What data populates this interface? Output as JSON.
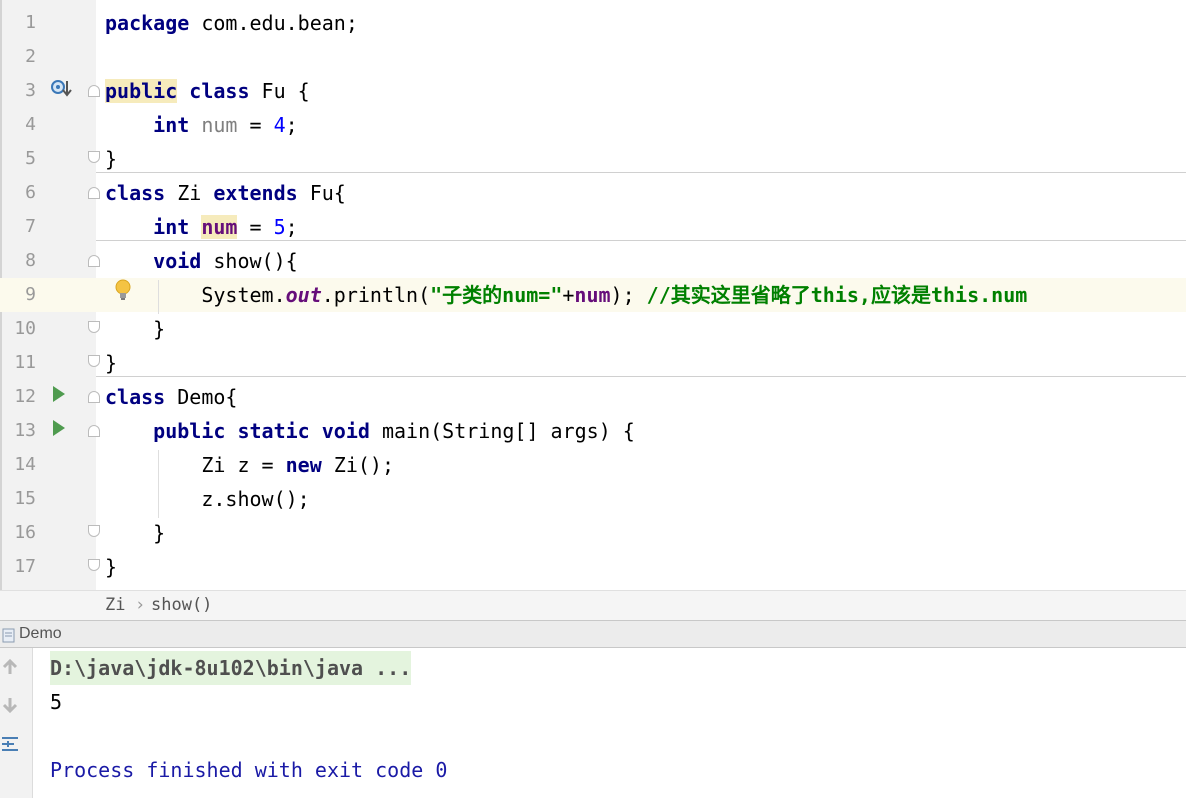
{
  "editor": {
    "line_numbers": [
      "1",
      "2",
      "3",
      "4",
      "5",
      "6",
      "7",
      "8",
      "9",
      "10",
      "11",
      "12",
      "13",
      "14",
      "15",
      "16",
      "17"
    ],
    "lines": {
      "l1": {
        "kw": "package",
        "rest": " com.edu.bean;"
      },
      "l3": {
        "kw_public": "public",
        "kw_class": "class",
        "rest": " Fu {"
      },
      "l4": {
        "kw": "int",
        "field": "num",
        "eq": " = ",
        "num": "4",
        "end": ";"
      },
      "l5": {
        "text": "}"
      },
      "l6": {
        "kw_class": "class",
        "mid": " Zi ",
        "kw_extends": "extends",
        "rest": " Fu{"
      },
      "l7": {
        "kw": "int",
        "field": "num",
        "eq": " = ",
        "num": "5",
        "end": ";"
      },
      "l8": {
        "kw": "void",
        "rest": " show(){"
      },
      "l9": {
        "pre": "System.",
        "static_field": "out",
        "call": ".println(",
        "str": "\"子类的num=\"",
        "plus": "+",
        "field": "num",
        "end": "); ",
        "comment": "//其实这里省略了this,应该是this.num"
      },
      "l10": {
        "text": "}"
      },
      "l11": {
        "text": "}"
      },
      "l12": {
        "kw_class": "class",
        "rest": " Demo{"
      },
      "l13": {
        "kw_public": "public",
        "kw_static": "static",
        "kw_void": "void",
        "rest": " main(String[] args) {"
      },
      "l14": {
        "pre": "Zi z = ",
        "kw": "new",
        "rest": " Zi();"
      },
      "l15": {
        "text": "z.show();"
      },
      "l16": {
        "text": "}"
      },
      "l17": {
        "text": "}"
      }
    }
  },
  "breadcrumb": {
    "class_name": "Zi",
    "separator": "›",
    "method": "show()"
  },
  "run_panel": {
    "tab_label": "Demo"
  },
  "console": {
    "command": "D:\\java\\jdk-8u102\\bin\\java ...",
    "output": "5",
    "finished": "Process finished with exit code 0"
  },
  "colors": {
    "keyword": "#000080",
    "field": "#660e7a",
    "string": "#008000",
    "number": "#0000ff",
    "current_line": "#fcfaed"
  }
}
